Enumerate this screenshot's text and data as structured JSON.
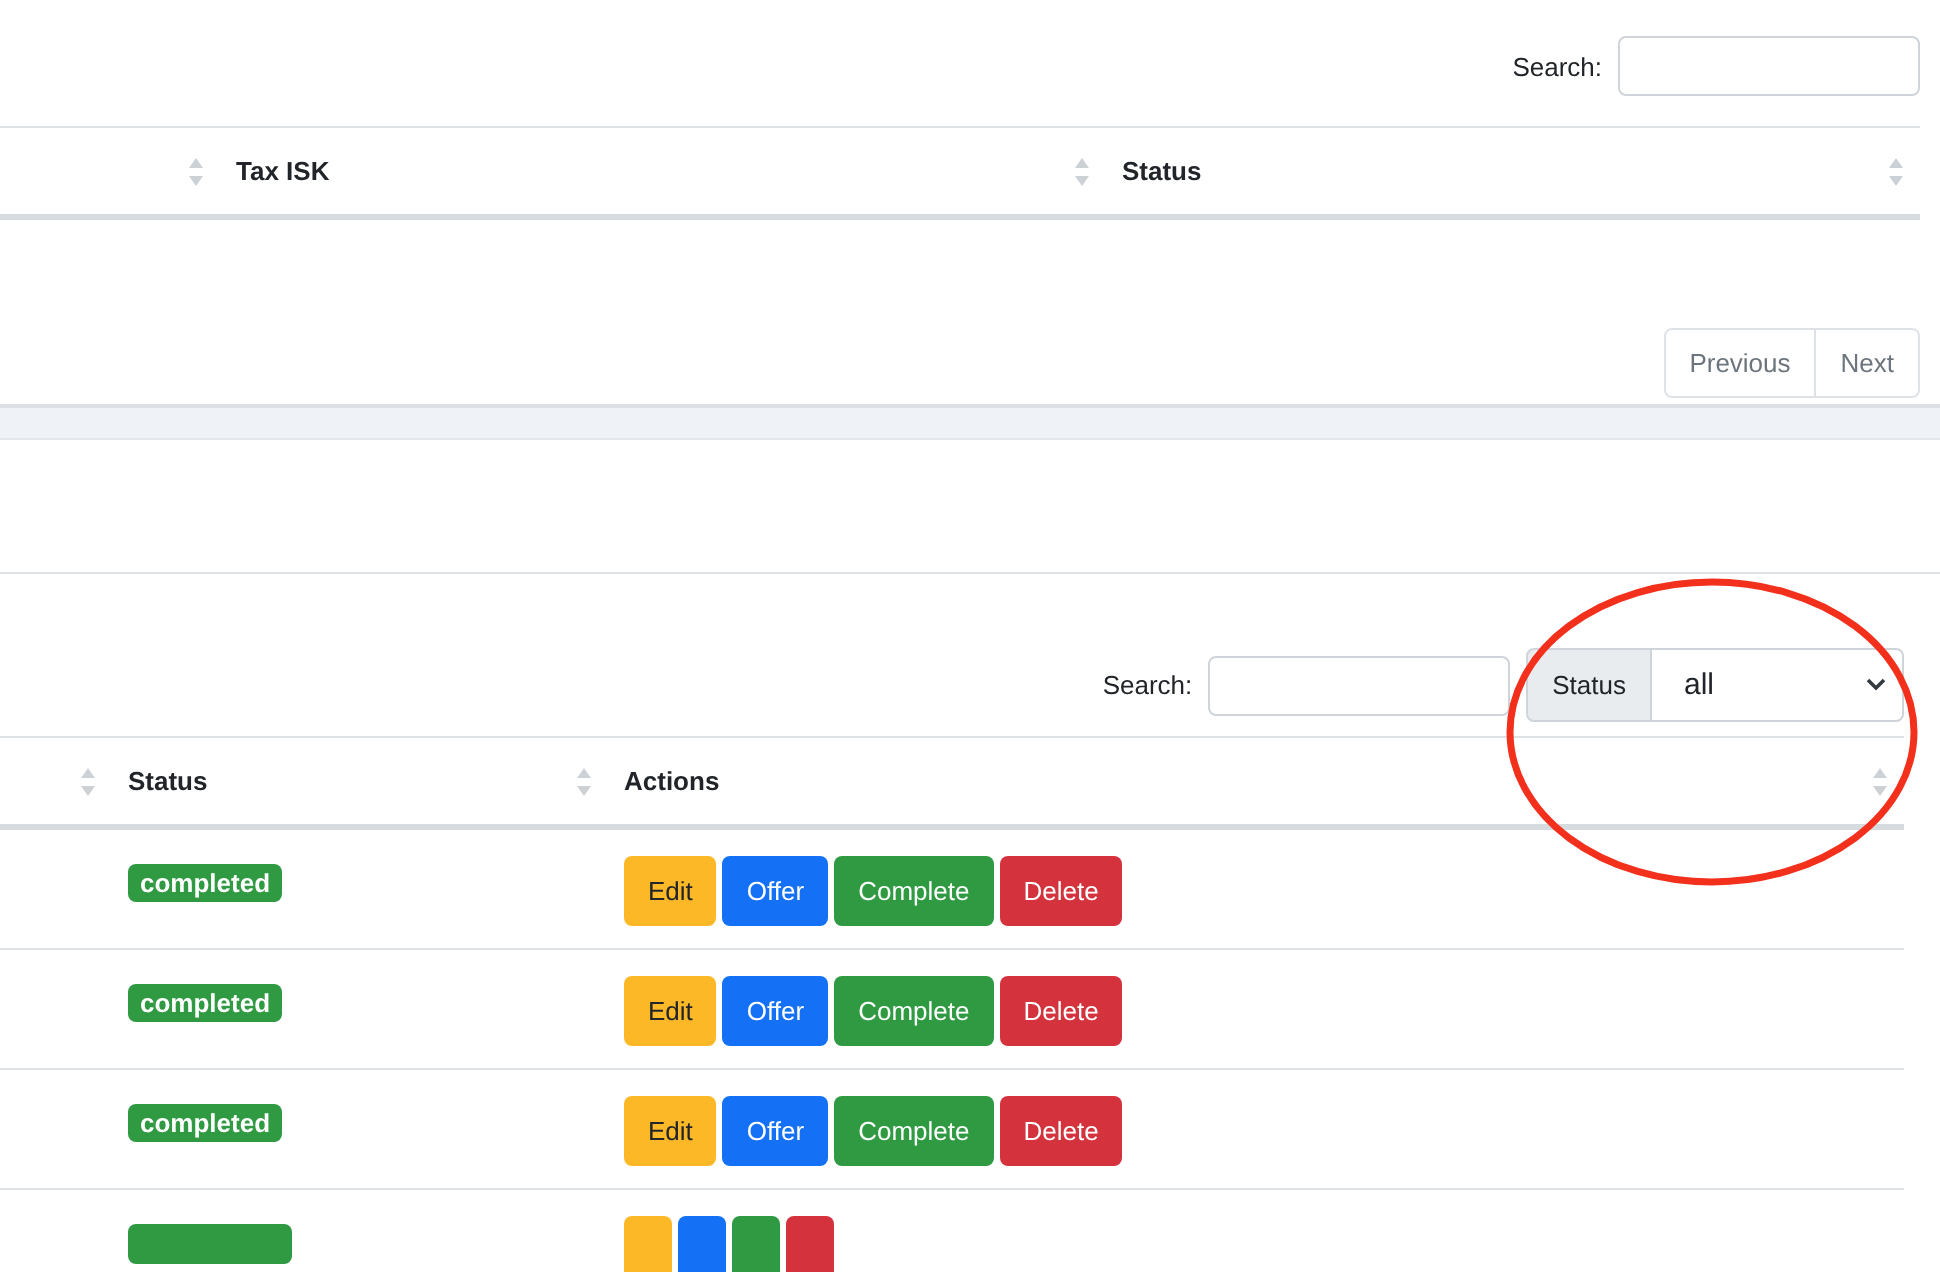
{
  "top_table": {
    "search": {
      "label": "Search:"
    },
    "columns": [
      {
        "sortable": true
      },
      {
        "label": "Tax ISK",
        "sortable": true
      },
      {
        "label": "Status",
        "sortable": true
      }
    ],
    "pagination": [
      "Previous",
      "Next"
    ]
  },
  "bottom_table": {
    "search": {
      "label": "Search:"
    },
    "filter": {
      "label": "Status",
      "value": "all"
    },
    "columns": [
      {
        "sortable": true
      },
      {
        "label": "Status",
        "sortable": true
      },
      {
        "label": "Actions",
        "sortable": true
      }
    ],
    "rows": [
      {
        "status": "completed",
        "actions": [
          {
            "kind": "edit",
            "label": "Edit"
          },
          {
            "kind": "offer",
            "label": "Offer"
          },
          {
            "kind": "complete",
            "label": "Complete"
          },
          {
            "kind": "delete",
            "label": "Delete"
          }
        ]
      },
      {
        "status": "completed",
        "actions": [
          {
            "kind": "edit",
            "label": "Edit"
          },
          {
            "kind": "offer",
            "label": "Offer"
          },
          {
            "kind": "complete",
            "label": "Complete"
          },
          {
            "kind": "delete",
            "label": "Delete"
          }
        ]
      },
      {
        "status": "completed",
        "actions": [
          {
            "kind": "edit",
            "label": "Edit"
          },
          {
            "kind": "offer",
            "label": "Offer"
          },
          {
            "kind": "complete",
            "label": "Complete"
          },
          {
            "kind": "delete",
            "label": "Delete"
          }
        ]
      },
      {
        "clipped": true,
        "actions": [
          {
            "kind": "edit"
          },
          {
            "kind": "offer"
          },
          {
            "kind": "complete"
          },
          {
            "kind": "delete"
          }
        ]
      }
    ]
  },
  "highlight_ellipse": true
}
